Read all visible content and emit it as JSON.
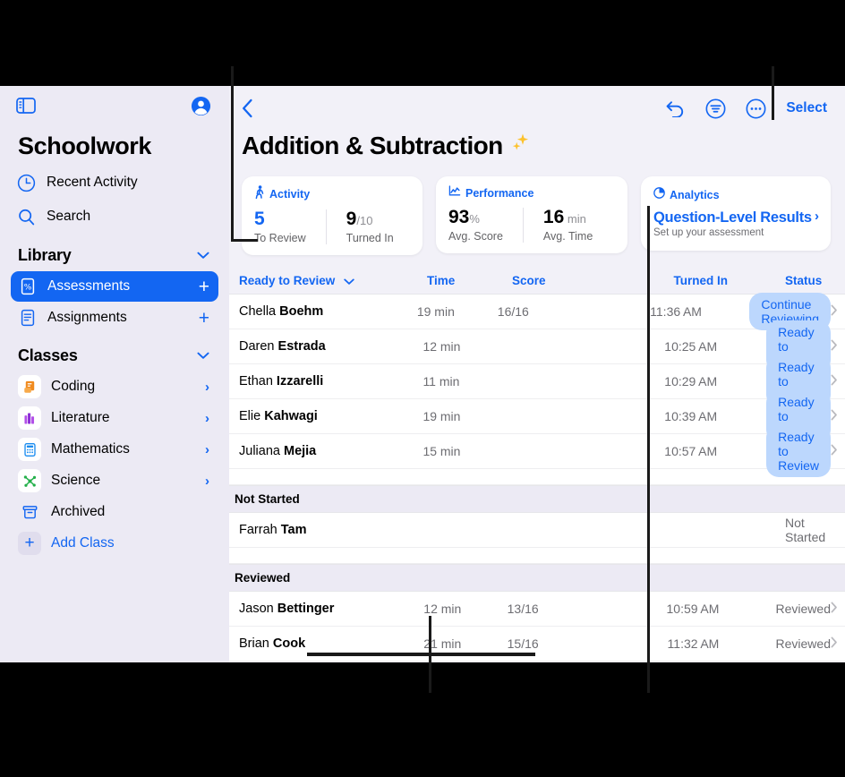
{
  "sidebar": {
    "toggle_icon": "sidebar-toggle-icon",
    "account_icon": "account-circle-icon",
    "title": "Schoolwork",
    "nav": [
      {
        "label": "Recent Activity",
        "icon": "clock-icon"
      },
      {
        "label": "Search",
        "icon": "search-icon"
      }
    ],
    "library": {
      "header": "Library",
      "items": [
        {
          "label": "Assessments",
          "icon": "assessment-percent-icon",
          "selected": true,
          "action": "+"
        },
        {
          "label": "Assignments",
          "icon": "assignment-doc-icon",
          "selected": false,
          "action": "+"
        }
      ]
    },
    "classes": {
      "header": "Classes",
      "items": [
        {
          "label": "Coding",
          "icon": "coding-scroll-icon",
          "color": "#f08a1e",
          "chevron": "›"
        },
        {
          "label": "Literature",
          "icon": "literature-books-icon",
          "color": "#a03ae0",
          "chevron": "›"
        },
        {
          "label": "Mathematics",
          "icon": "calculator-icon",
          "color": "#1a8cf0",
          "chevron": "›"
        },
        {
          "label": "Science",
          "icon": "molecule-icon",
          "color": "#23b04a",
          "chevron": "›"
        }
      ],
      "archived": {
        "label": "Archived",
        "icon": "archive-box-icon"
      },
      "add_class": {
        "label": "Add Class",
        "icon": "plus-icon"
      }
    }
  },
  "toolbar": {
    "back_icon": "chevron-left-icon",
    "undo_icon": "undo-arrow-icon",
    "filter_icon": "filter-list-icon",
    "more_icon": "more-ellipsis-icon",
    "select_label": "Select"
  },
  "page": {
    "title": "Addition & Subtraction",
    "title_emoji": "✨"
  },
  "cards": {
    "activity": {
      "header": "Activity",
      "icon": "person-walking-icon",
      "stats": [
        {
          "value": "5",
          "suffix": "",
          "label": "To Review",
          "highlight": true
        },
        {
          "value": "9",
          "suffix": "/10",
          "label": "Turned In",
          "highlight": false
        }
      ]
    },
    "performance": {
      "header": "Performance",
      "icon": "chart-line-icon",
      "stats": [
        {
          "value": "93",
          "suffix": "%",
          "label": "Avg. Score",
          "highlight": false
        },
        {
          "value": "16",
          "suffix": " min",
          "label": "Avg. Time",
          "highlight": false
        }
      ]
    },
    "analytics": {
      "header": "Analytics",
      "icon": "pie-chart-clock-icon",
      "title": "Question-Level Results",
      "subtitle": "Set up your assessment",
      "chevron": "›"
    }
  },
  "table": {
    "columns": {
      "name": "Ready to Review",
      "name_sort_icon": "chevron-down-icon",
      "time": "Time",
      "score": "Score",
      "turned_in": "Turned In",
      "status": "Status"
    },
    "groups": [
      {
        "header": null,
        "rows": [
          {
            "first": "Chella ",
            "last": "Boehm",
            "time": "19 min",
            "score": "16/16",
            "turned_in": "11:36 AM",
            "status": "Continue Reviewing",
            "badge": true,
            "chevron": "›"
          },
          {
            "first": "Daren ",
            "last": "Estrada",
            "time": "12 min",
            "score": "",
            "turned_in": "10:25 AM",
            "status": "Ready to Review",
            "badge": true,
            "chevron": "›"
          },
          {
            "first": "Ethan ",
            "last": "Izzarelli",
            "time": "11 min",
            "score": "",
            "turned_in": "10:29 AM",
            "status": "Ready to Review",
            "badge": true,
            "chevron": "›"
          },
          {
            "first": "Elie ",
            "last": "Kahwagi",
            "time": "19 min",
            "score": "",
            "turned_in": "10:39 AM",
            "status": "Ready to Review",
            "badge": true,
            "chevron": "›"
          },
          {
            "first": "Juliana ",
            "last": "Mejia",
            "time": "15 min",
            "score": "",
            "turned_in": "10:57 AM",
            "status": "Ready to Review",
            "badge": true,
            "chevron": "›"
          }
        ]
      },
      {
        "header": "Not Started",
        "rows": [
          {
            "first": "Farrah ",
            "last": "Tam",
            "time": "",
            "score": "",
            "turned_in": "",
            "status": "Not Started",
            "badge": false,
            "chevron": ""
          }
        ]
      },
      {
        "header": "Reviewed",
        "rows": [
          {
            "first": "Jason ",
            "last": "Bettinger",
            "time": "12 min",
            "score": "13/16",
            "turned_in": "10:59 AM",
            "status": "Reviewed",
            "badge": false,
            "chevron": "›"
          },
          {
            "first": "Brian ",
            "last": "Cook",
            "time": "21 min",
            "score": "15/16",
            "turned_in": "11:32 AM",
            "status": "Reviewed",
            "badge": false,
            "chevron": "›"
          }
        ]
      }
    ]
  },
  "colors": {
    "accent": "#1366f2",
    "badge_bg": "#bcd7fd",
    "sidebar_bg": "#eceaf4",
    "main_bg": "#f2f1f8"
  }
}
